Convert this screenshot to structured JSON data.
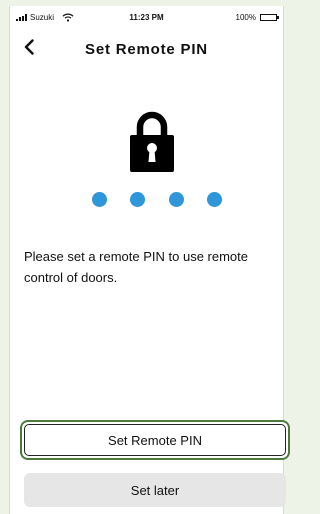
{
  "status_bar": {
    "carrier": "Suzuki",
    "time": "11:23 PM",
    "battery": "100%"
  },
  "header": {
    "title": "Set Remote PIN",
    "back_icon": "chevron-left-icon"
  },
  "main": {
    "lock_icon": "lock-icon",
    "pin_length": 4,
    "message": "Please set a remote PIN to use remote control of doors."
  },
  "actions": {
    "primary_label": "Set Remote PIN",
    "secondary_label": "Set later"
  },
  "colors": {
    "accent_dot": "#2f96d9",
    "focus_outline": "#4c7a3b",
    "secondary_bg": "#e6e6e6"
  }
}
